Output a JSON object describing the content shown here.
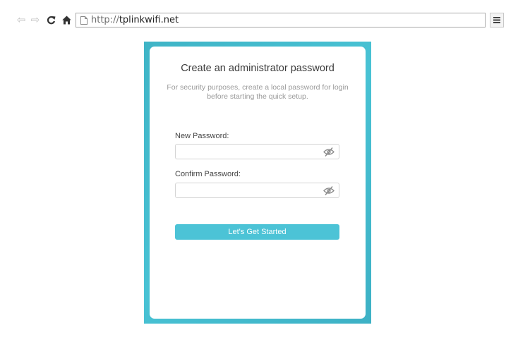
{
  "browser": {
    "url_prefix": "http://",
    "url_domain": "tplinkwifi.net",
    "icons": {
      "back": "arrow-left-icon",
      "forward": "arrow-right-icon",
      "reload": "reload-icon",
      "home": "home-icon",
      "page": "page-icon",
      "menu": "hamburger-menu-icon"
    }
  },
  "setup": {
    "title": "Create an administrator password",
    "subtitle": "For security purposes, create a local password for login before starting the quick setup.",
    "new_password_label": "New Password:",
    "new_password_value": "",
    "confirm_password_label": "Confirm Password:",
    "confirm_password_value": "",
    "submit_label": "Let's Get Started"
  },
  "colors": {
    "frame": "#45bccf",
    "button": "#4cc3d6",
    "button_text": "#ffffff"
  }
}
